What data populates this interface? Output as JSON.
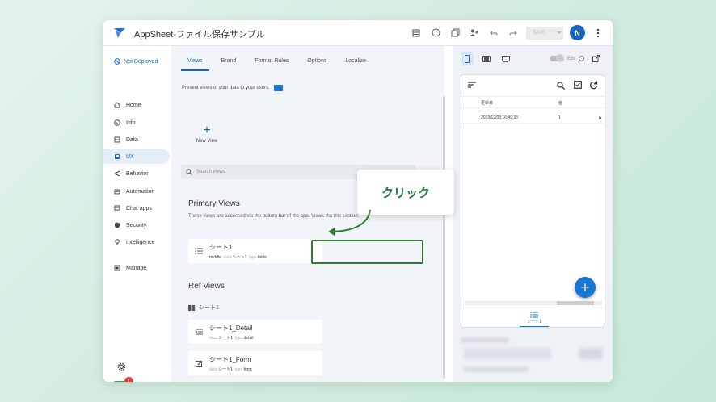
{
  "app": {
    "title": "AppSheet-ファイル保存サンプル"
  },
  "toolbar": {
    "save_label": "SAVE",
    "avatar_initial": "N"
  },
  "sidebar": {
    "deploy_status": "Not Deployed",
    "items": [
      {
        "label": "Home",
        "icon": "home-icon"
      },
      {
        "label": "Info",
        "icon": "info-icon"
      },
      {
        "label": "Data",
        "icon": "data-icon"
      },
      {
        "label": "UX",
        "icon": "ux-icon",
        "active": true
      },
      {
        "label": "Behavior",
        "icon": "behavior-icon"
      },
      {
        "label": "Automation",
        "icon": "automation-icon"
      },
      {
        "label": "Chat apps",
        "icon": "chat-icon"
      },
      {
        "label": "Security",
        "icon": "security-icon"
      },
      {
        "label": "Intelligence",
        "icon": "intelligence-icon"
      },
      {
        "label": "Manage",
        "icon": "manage-icon"
      }
    ],
    "notification_count": "1"
  },
  "center": {
    "tabs": [
      "Views",
      "Brand",
      "Format Rules",
      "Options",
      "Localize"
    ],
    "active_tab": "Views",
    "subtitle": "Present views of your data to your users.",
    "new_view_label": "New View",
    "search_placeholder": "Search views",
    "primary_title": "Primary Views",
    "primary_desc": "These views are accessed via the bottom bar of the app. Views tha this section.",
    "primary_views": [
      {
        "name": "シート1",
        "position": "middle",
        "data_label": "data",
        "data": "シート1",
        "type_label": "type",
        "type": "table"
      }
    ],
    "ref_title": "Ref Views",
    "ref_group": "シート1",
    "ref_views": [
      {
        "name": "シート1_Detail",
        "data_label": "data",
        "data": "シート1",
        "type_label": "type",
        "type": "detail"
      },
      {
        "name": "シート1_Form",
        "data_label": "data",
        "data": "シート1",
        "type_label": "type",
        "type": "form"
      }
    ]
  },
  "callout": {
    "text": "クリック",
    "color": "#1e7a3c"
  },
  "preview": {
    "edit_label": "Edit",
    "table": {
      "headers": [
        "更新日",
        "値"
      ],
      "rows": [
        {
          "date": "2023/12/08 16:49:33",
          "value": "1"
        }
      ]
    },
    "nav_label": "シート1"
  },
  "colors": {
    "accent": "#1565c0",
    "highlight": "#2e7d32",
    "status_ok": "#3d9944",
    "badge": "#e53935"
  }
}
